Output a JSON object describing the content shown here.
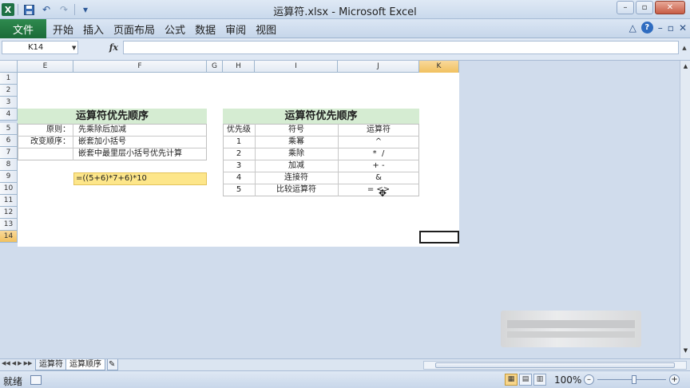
{
  "window": {
    "title": "运算符.xlsx - Microsoft Excel",
    "minimize": "–",
    "restore": "▫",
    "close": "✕"
  },
  "qat": {
    "logo": "X",
    "save_icon": "save-icon",
    "undo": "↶",
    "redo": "↷",
    "dropdown": "▾"
  },
  "ribbon": {
    "file_tab": "文件",
    "tabs": [
      "开始",
      "插入",
      "页面布局",
      "公式",
      "数据",
      "审阅",
      "视图"
    ],
    "help": "?",
    "right_icons": [
      "△",
      "?",
      "–",
      "▫",
      "✕"
    ]
  },
  "formula_bar": {
    "name_box": "K14",
    "fx": "fx",
    "formula": ""
  },
  "columns": [
    {
      "label": "E"
    },
    {
      "label": "F"
    },
    {
      "label": "G"
    },
    {
      "label": "H"
    },
    {
      "label": "I"
    },
    {
      "label": "J"
    },
    {
      "label": "K"
    }
  ],
  "rows": [
    "1",
    "2",
    "3",
    "4",
    "5",
    "6",
    "7",
    "8",
    "9",
    "10",
    "11",
    "12",
    "13",
    "14"
  ],
  "left_table": {
    "title": "运算符优先顺序",
    "principle_label": "原则：",
    "principle": "先乘除后加减",
    "change_label": "改变顺序：",
    "change_1": "嵌套加小括号",
    "change_2": "嵌套中最里层小括号优先计算",
    "formula_example": "=((5+6)*7+6)*10"
  },
  "right_table": {
    "title": "运算符优先顺序",
    "headers": [
      "优先级",
      "符号",
      "运算符"
    ],
    "rows": [
      [
        "1",
        "乘幂",
        "^"
      ],
      [
        "2",
        "乘除",
        "*  /"
      ],
      [
        "3",
        "加减",
        "+ -"
      ],
      [
        "4",
        "连接符",
        "&"
      ],
      [
        "5",
        "比较运算符",
        "= <>"
      ]
    ]
  },
  "sheets": {
    "tabs": [
      "运算符",
      "运算顺序"
    ],
    "active": "运算顺序"
  },
  "status": {
    "ready": "就绪",
    "zoom": "100%",
    "minus": "–",
    "plus": "+"
  }
}
